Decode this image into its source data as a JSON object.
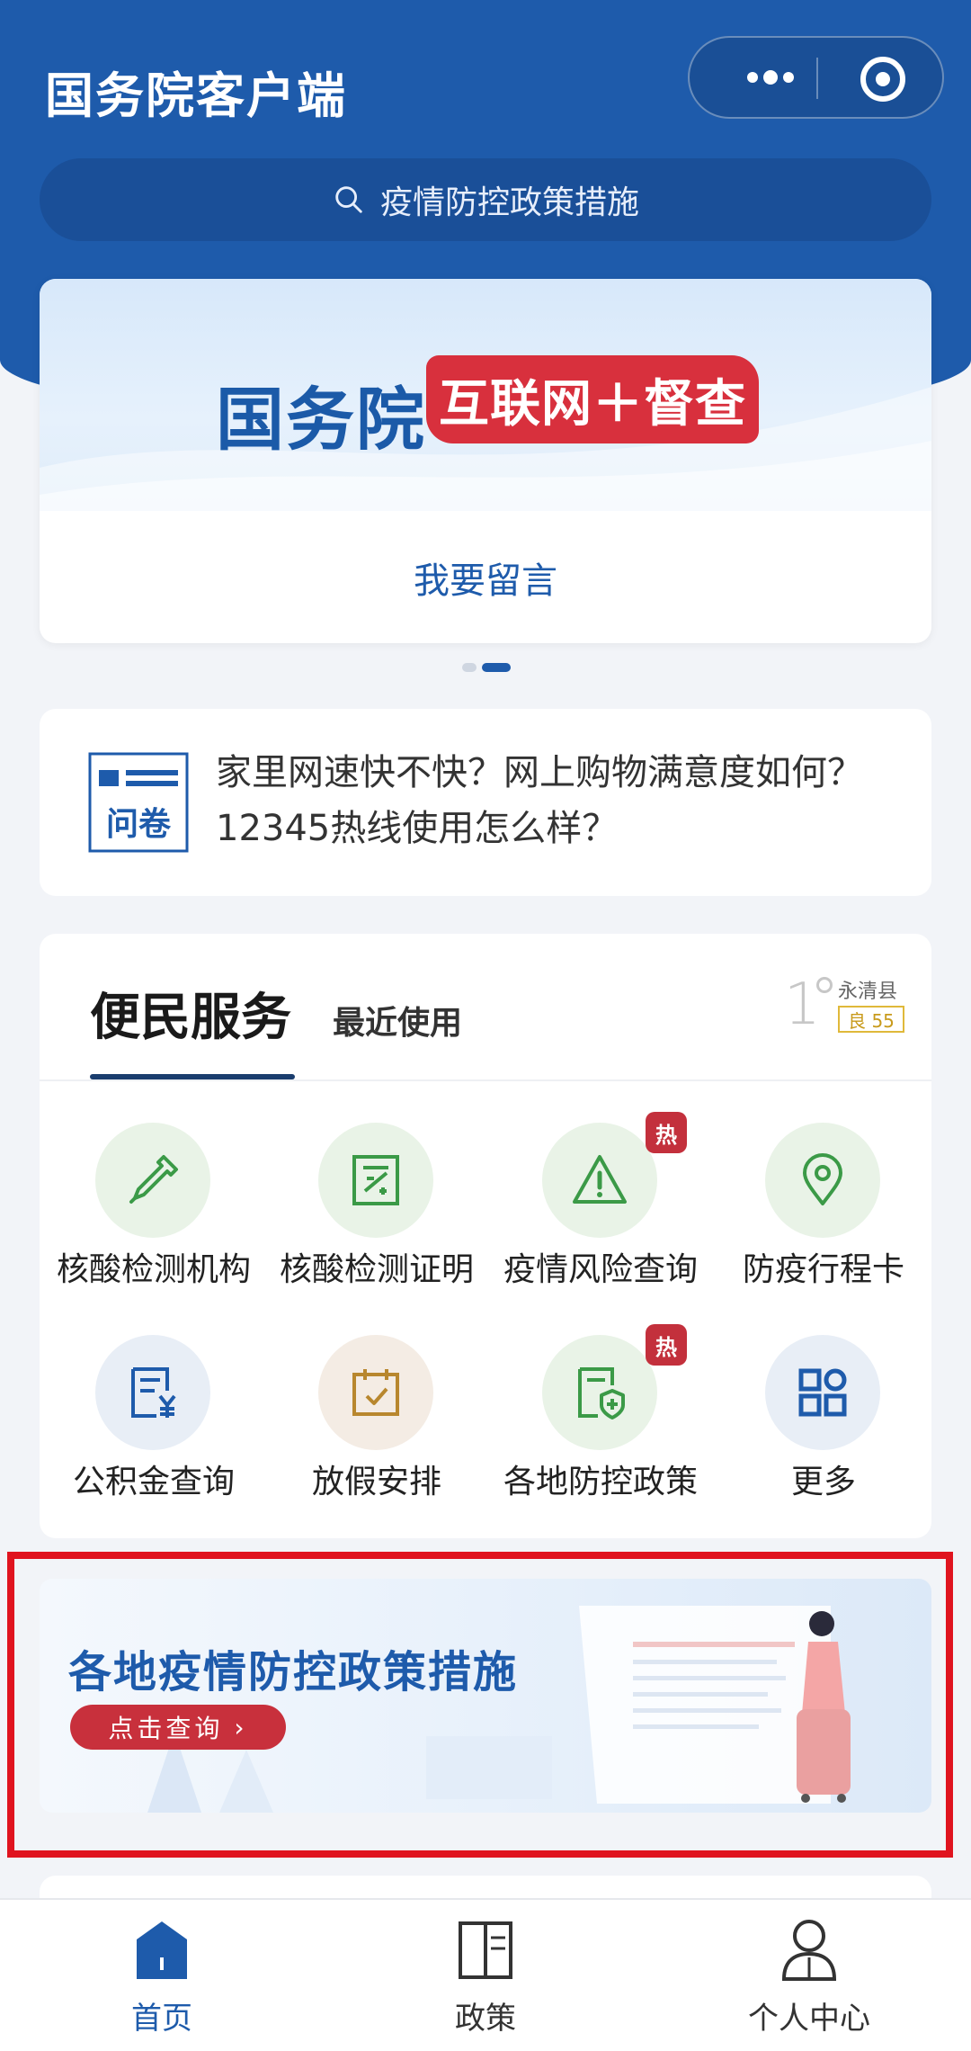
{
  "header": {
    "title": "国务院客户端",
    "search_placeholder": "疫情防控政策措施"
  },
  "banner": {
    "brand": "国务院",
    "tag": "互联网＋督查",
    "link_label": "我要留言"
  },
  "survey": {
    "icon_label": "问卷",
    "text": "家里网速快不快？网上购物满意度如何？12345热线使用怎么样？"
  },
  "services": {
    "tab_main": "便民服务",
    "tab_recent": "最近使用",
    "weather": {
      "temp": "1",
      "location": "永清县",
      "aqi": "良 55"
    },
    "hot_badge": "热",
    "items": [
      {
        "label": "核酸检测机构",
        "icon": "dropper-icon"
      },
      {
        "label": "核酸检测证明",
        "icon": "certificate-icon"
      },
      {
        "label": "疫情风险查询",
        "icon": "warning-icon",
        "hot": true
      },
      {
        "label": "防疫行程卡",
        "icon": "location-pin-icon"
      },
      {
        "label": "公积金查询",
        "icon": "fund-bill-icon"
      },
      {
        "label": "放假安排",
        "icon": "calendar-check-icon"
      },
      {
        "label": "各地防控政策",
        "icon": "shield-document-icon",
        "hot": true
      },
      {
        "label": "更多",
        "icon": "grid-more-icon"
      }
    ]
  },
  "promo": {
    "title": "各地疫情防控政策措施",
    "button": "点击查询"
  },
  "tabbar": {
    "home": "首页",
    "policy": "政策",
    "profile": "个人中心"
  },
  "colors": {
    "brand_blue": "#1e5bab",
    "accent_red": "#d8303d",
    "icon_green": "#3b9a47"
  }
}
